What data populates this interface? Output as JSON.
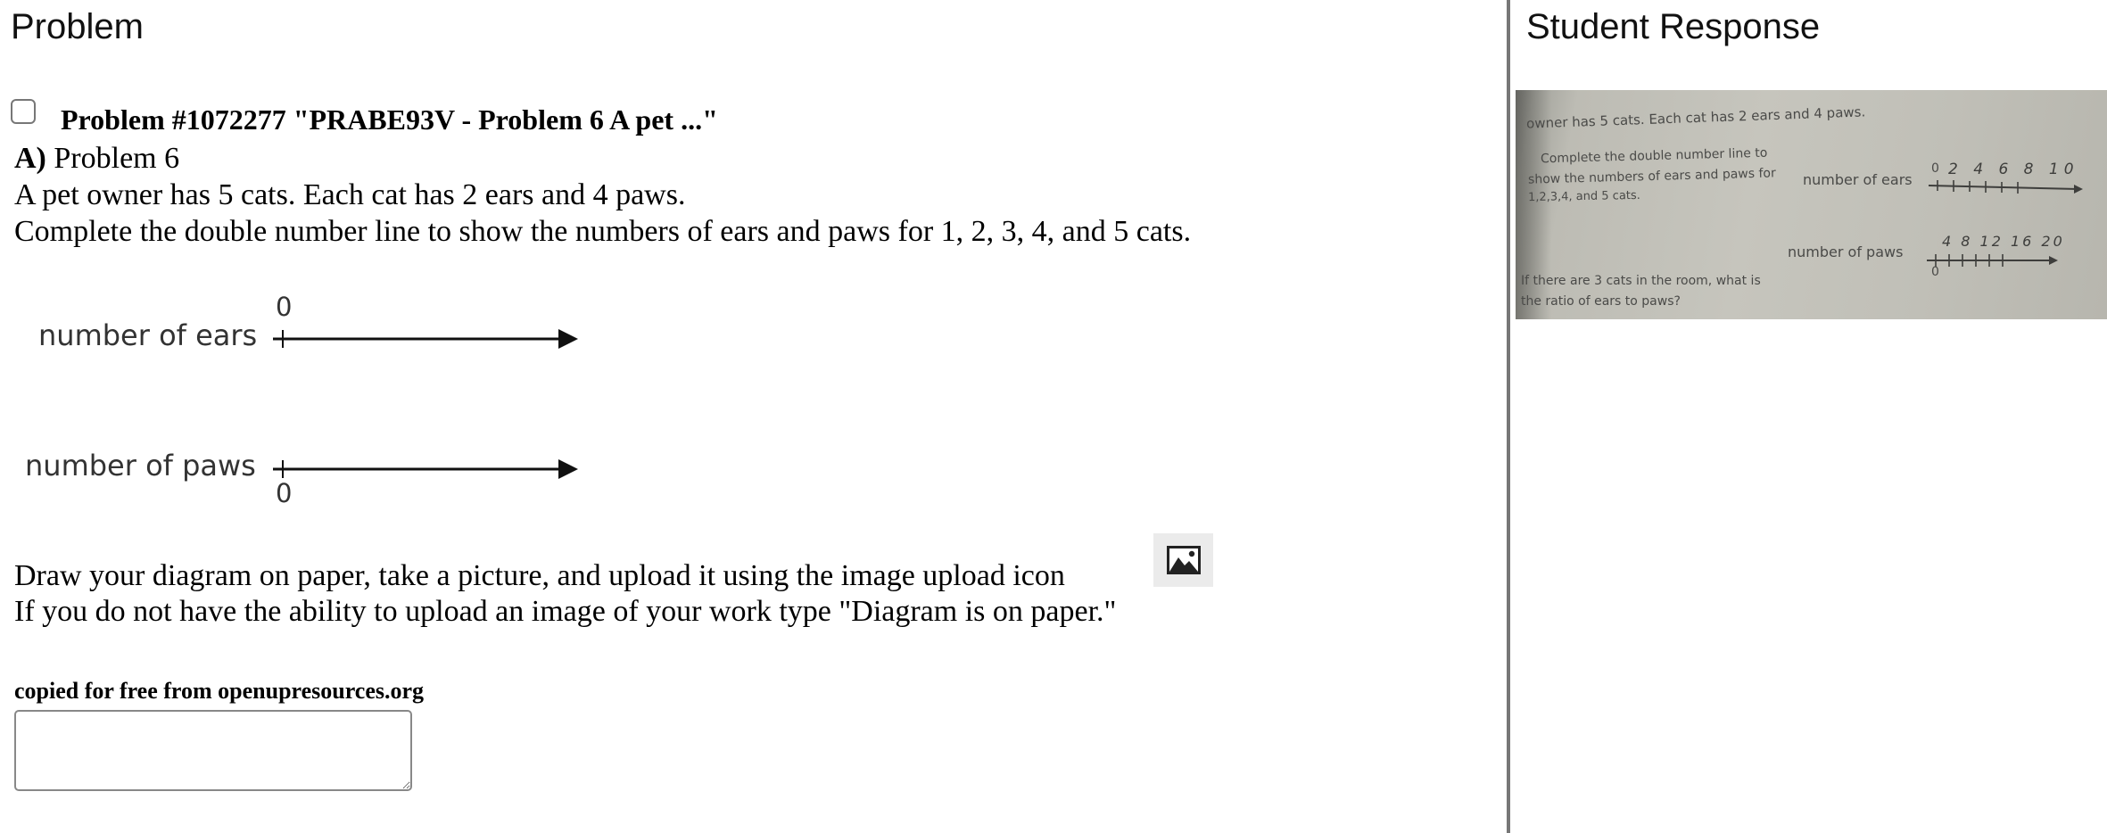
{
  "left_heading": "Problem",
  "right_heading": "Student Response",
  "problem": {
    "title": "Problem #1072277 \"PRABE93V - Problem 6 A pet ...\"",
    "part_letter": "A)",
    "part_title": "Problem 6",
    "statement_1": "A pet owner has 5 cats. Each cat has 2 ears and 4 paws.",
    "statement_2": "Complete the double number line to show the numbers of ears and paws for 1, 2, 3, 4, and 5 cats.",
    "diagram": {
      "ears_label": "number of ears",
      "paws_label": "number of paws",
      "ears_zero": "0",
      "paws_zero": "0"
    },
    "instruction_1": "Draw your diagram on paper, take a picture, and upload it using the image upload icon",
    "instruction_2": "If you do not have the ability to upload an image of your work type \"Diagram is on paper.\"",
    "source": "copied for free from openupresources.org",
    "answer_value": ""
  },
  "student_photo": {
    "line_1": "owner has 5 cats. Each cat has 2 ears and 4 paws.",
    "line_2": "Complete the double number line to",
    "line_3": "show the numbers of ears and paws for",
    "line_4": "1,2,3,4, and 5 cats.",
    "line_5": "If there are 3 cats in the room, what is",
    "line_6": "the ratio of ears to paws?",
    "ears_label": "number of ears",
    "paws_label": "number of paws",
    "ears_zero": "0",
    "paws_zero": "0",
    "ears_values": "2 4 6 8 10",
    "paws_values": "4 8 12 16 20"
  },
  "icons": {
    "checkbox": "checkbox-icon",
    "upload": "image-upload-icon"
  }
}
